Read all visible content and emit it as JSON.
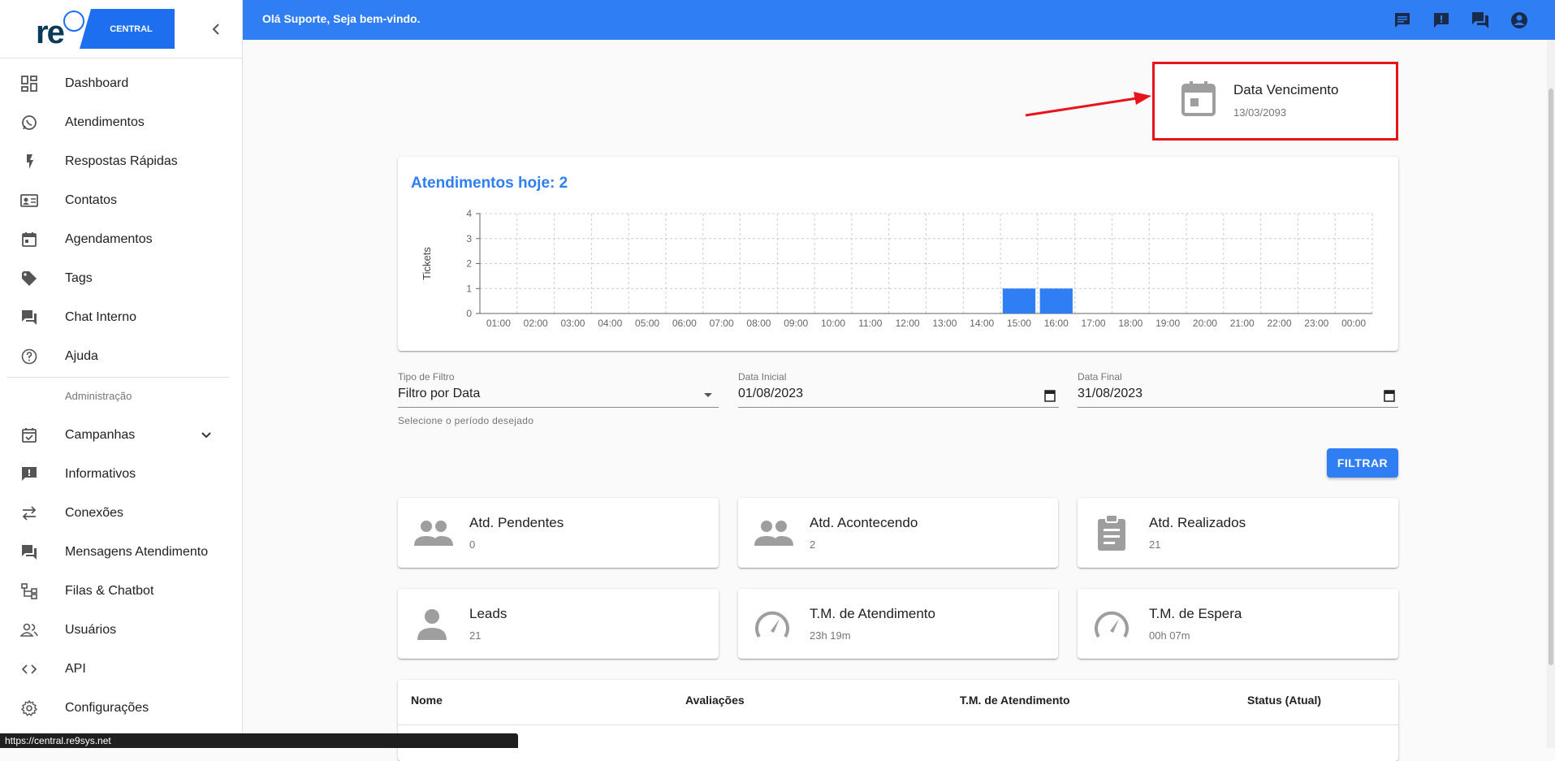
{
  "brand": {
    "logo_text": "re",
    "badge_text": "CENTRAL"
  },
  "sidebar": {
    "items": [
      {
        "label": "Dashboard",
        "icon": "dashboard-icon"
      },
      {
        "label": "Atendimentos",
        "icon": "whatsapp-icon"
      },
      {
        "label": "Respostas Rápidas",
        "icon": "flash-icon"
      },
      {
        "label": "Contatos",
        "icon": "contact-card-icon"
      },
      {
        "label": "Agendamentos",
        "icon": "calendar-icon"
      },
      {
        "label": "Tags",
        "icon": "tag-icon"
      },
      {
        "label": "Chat Interno",
        "icon": "forum-icon"
      },
      {
        "label": "Ajuda",
        "icon": "help-icon"
      }
    ],
    "section_label": "Administração",
    "admin_items": [
      {
        "label": "Campanhas",
        "icon": "event-check-icon"
      },
      {
        "label": "Informativos",
        "icon": "announcement-icon"
      },
      {
        "label": "Conexões",
        "icon": "swap-icon"
      },
      {
        "label": "Mensagens Atendimento",
        "icon": "message-icon"
      },
      {
        "label": "Filas & Chatbot",
        "icon": "tree-icon"
      },
      {
        "label": "Usuários",
        "icon": "people-icon"
      },
      {
        "label": "API",
        "icon": "code-icon"
      },
      {
        "label": "Configurações",
        "icon": "settings-icon"
      }
    ]
  },
  "topbar": {
    "greeting": "Olá Suporte, Seja bem-vindo."
  },
  "due_card": {
    "title": "Data Vencimento",
    "value": "13/03/2093"
  },
  "chart": {
    "title": "Atendimentos hoje: 2"
  },
  "chart_data": {
    "type": "bar",
    "title": "Atendimentos hoje: 2",
    "xlabel": "",
    "ylabel": "Tickets",
    "ylim": [
      0,
      4
    ],
    "yticks": [
      "0",
      "1",
      "2",
      "3",
      "4"
    ],
    "grid": true,
    "categories": [
      "01:00",
      "02:00",
      "03:00",
      "04:00",
      "05:00",
      "06:00",
      "07:00",
      "08:00",
      "09:00",
      "10:00",
      "11:00",
      "12:00",
      "13:00",
      "14:00",
      "15:00",
      "16:00",
      "17:00",
      "18:00",
      "19:00",
      "20:00",
      "21:00",
      "22:00",
      "23:00",
      "00:00"
    ],
    "values": [
      0,
      0,
      0,
      0,
      0,
      0,
      0,
      0,
      0,
      0,
      0,
      0,
      0,
      0,
      1,
      1,
      0,
      0,
      0,
      0,
      0,
      0,
      0,
      0
    ],
    "color": "#2f7ef4"
  },
  "filters": {
    "type": {
      "label": "Tipo de Filtro",
      "value": "Filtro por Data",
      "help": "Selecione o período desejado"
    },
    "start": {
      "label": "Data Inicial",
      "value": "01/08/2023"
    },
    "end": {
      "label": "Data Final",
      "value": "31/08/2023"
    },
    "button": "FILTRAR"
  },
  "stats": [
    {
      "title": "Atd. Pendentes",
      "value": "0",
      "icon": "group-icon"
    },
    {
      "title": "Atd. Acontecendo",
      "value": "2",
      "icon": "group-icon"
    },
    {
      "title": "Atd. Realizados",
      "value": "21",
      "icon": "assignment-icon"
    },
    {
      "title": "Leads",
      "value": "21",
      "icon": "person-icon"
    },
    {
      "title": "T.M. de Atendimento",
      "value": "23h 19m",
      "icon": "speed-icon"
    },
    {
      "title": "T.M. de Espera",
      "value": "00h 07m",
      "icon": "speed-icon"
    }
  ],
  "table": {
    "headers": [
      "Nome",
      "Avaliações",
      "T.M. de Atendimento",
      "Status (Atual)"
    ]
  },
  "status_url": "https://central.re9sys.net",
  "colors": {
    "primary": "#2f7ef4",
    "highlight": "#e8141c"
  }
}
